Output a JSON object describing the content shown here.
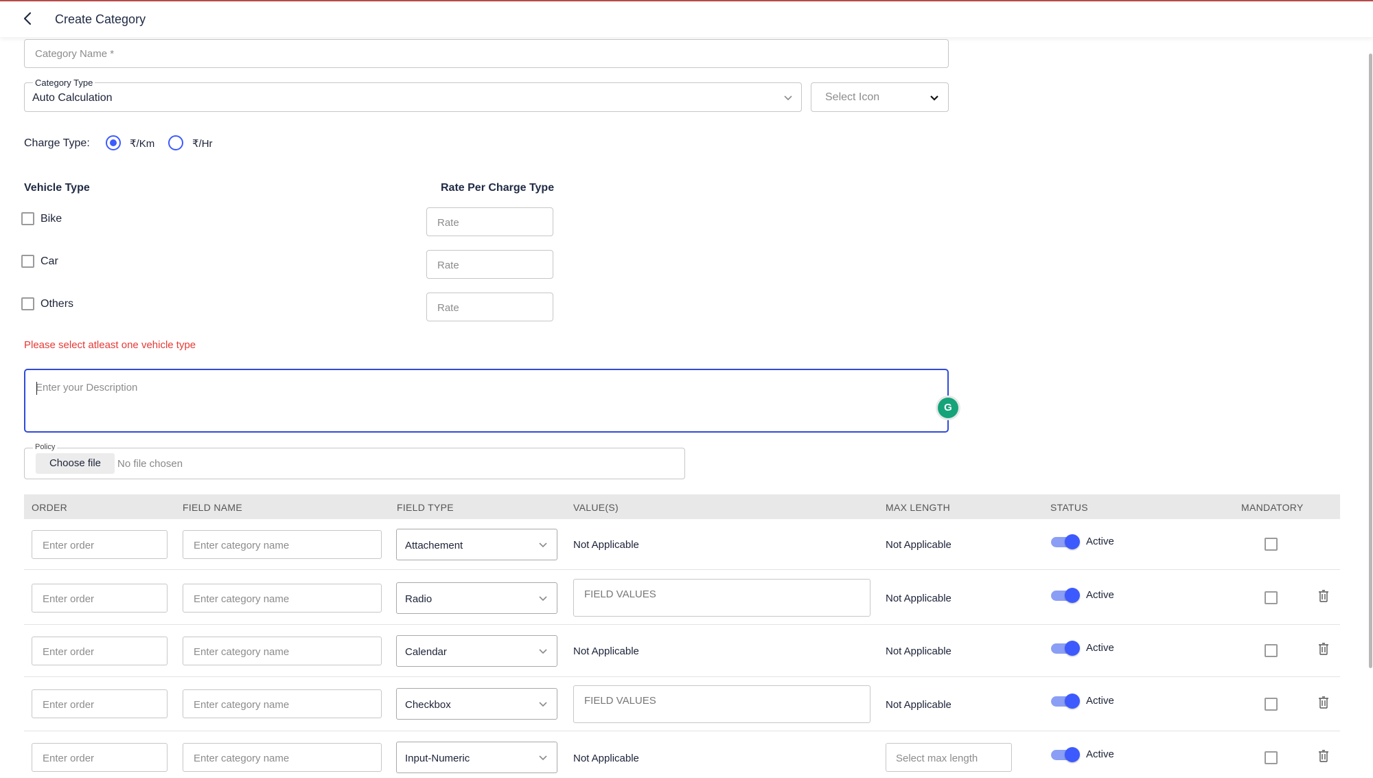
{
  "header": {
    "title": "Create Category"
  },
  "form": {
    "category_name_placeholder": "Category Name *",
    "category_type_label": "Category Type",
    "category_type_value": "Auto Calculation",
    "select_icon_placeholder": "Select Icon",
    "charge_type_label": "Charge Type:",
    "charge_options": [
      {
        "label": "₹/Km",
        "selected": true
      },
      {
        "label": "₹/Hr",
        "selected": false
      }
    ],
    "vehicle_type_heading": "Vehicle Type",
    "rate_heading": "Rate Per Charge Type",
    "vehicles": [
      {
        "label": "Bike",
        "checked": false,
        "rate_placeholder": "Rate"
      },
      {
        "label": "Car",
        "checked": false,
        "rate_placeholder": "Rate"
      },
      {
        "label": "Others",
        "checked": false,
        "rate_placeholder": "Rate"
      }
    ],
    "error_message": "Please select atleast one vehicle type",
    "description_placeholder": "Enter your Description",
    "grammarly_icon_letter": "G",
    "policy_label": "Policy",
    "choose_file_label": "Choose file",
    "no_file_text": "No file chosen"
  },
  "table": {
    "headers": [
      "ORDER",
      "FIELD NAME",
      "FIELD TYPE",
      "VALUE(S)",
      "MAX LENGTH",
      "STATUS",
      "MANDATORY"
    ],
    "rows": [
      {
        "order_placeholder": "Enter order",
        "name_placeholder": "Enter category name",
        "field_type": "Attachement",
        "values": "Not Applicable",
        "max_length": "Not Applicable",
        "status": "Active",
        "status_on": true,
        "mandatory": false
      },
      {
        "order_placeholder": "Enter order",
        "name_placeholder": "Enter category name",
        "field_type": "Radio",
        "values_placeholder": "FIELD VALUES",
        "max_length": "Not Applicable",
        "status": "Active",
        "status_on": true,
        "mandatory": false
      },
      {
        "order_placeholder": "Enter order",
        "name_placeholder": "Enter category name",
        "field_type": "Calendar",
        "values": "Not Applicable",
        "max_length": "Not Applicable",
        "status": "Active",
        "status_on": true,
        "mandatory": false
      },
      {
        "order_placeholder": "Enter order",
        "name_placeholder": "Enter category name",
        "field_type": "Checkbox",
        "values_placeholder": "FIELD VALUES",
        "max_length": "Not Applicable",
        "status": "Active",
        "status_on": true,
        "mandatory": false
      },
      {
        "order_placeholder": "Enter order",
        "name_placeholder": "Enter category name",
        "field_type": "Input-Numeric",
        "values": "Not Applicable",
        "max_length_placeholder": "Select max length",
        "status": "Active",
        "status_on": true,
        "mandatory": false
      }
    ]
  },
  "colors": {
    "accent": "#3d5afe",
    "error": "#e53935",
    "focus_border": "#2f4bd8",
    "grammarly": "#15a37a",
    "table_header_bg": "#e8e8e8"
  }
}
